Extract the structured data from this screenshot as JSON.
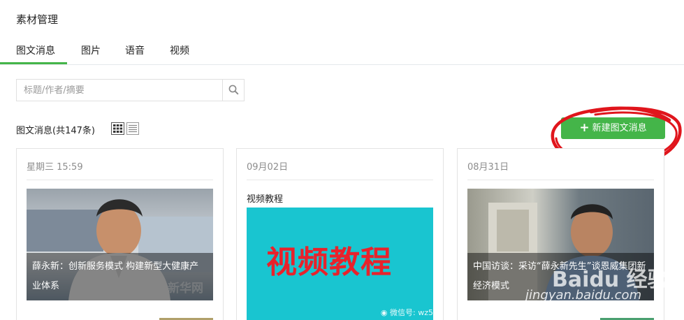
{
  "page": {
    "title": "素材管理"
  },
  "tabs": [
    {
      "label": "图文消息",
      "active": true
    },
    {
      "label": "图片",
      "active": false
    },
    {
      "label": "语音",
      "active": false
    },
    {
      "label": "视频",
      "active": false
    }
  ],
  "search": {
    "placeholder": "标题/作者/摘要",
    "value": ""
  },
  "toolbar": {
    "count_label": "图文消息(共147条)",
    "new_button_label": "新建图文消息"
  },
  "cards": [
    {
      "date": "星期三 15:59",
      "caption": "薛永新：创新服务模式 构建新型大健康产业体系",
      "thumb_mark": "新华网"
    },
    {
      "date": "09月02日",
      "title": "视频教程",
      "thumb_text": "视频教程",
      "thumb_mark": "微信号: wz5"
    },
    {
      "date": "08月31日",
      "caption": "中国访谈：采访“薛永新先生”谈恩威集团新经济模式",
      "thumb_mark": "Baidu 经验"
    }
  ],
  "watermark": {
    "url": "jingyan.baidu.com"
  },
  "colors": {
    "accent": "#44b549",
    "annotation": "#e0151c",
    "video_bg": "#19c5d0",
    "video_text": "#e8222b"
  }
}
